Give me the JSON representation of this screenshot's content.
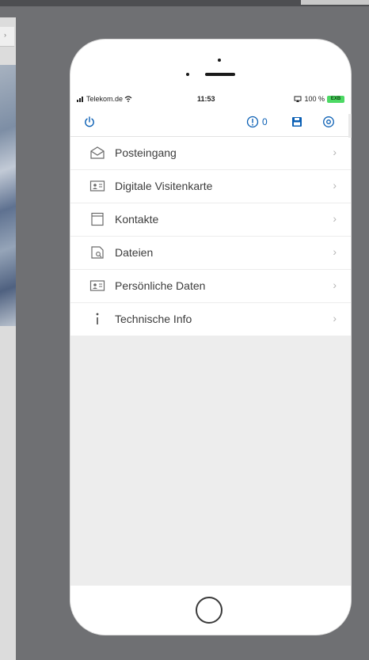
{
  "status_bar": {
    "carrier": "Telekom.de",
    "time": "11:53",
    "battery_percent": "100 %",
    "battery_badge": "EXB"
  },
  "toolbar": {
    "info_count": "0"
  },
  "menu": {
    "items": [
      {
        "label": "Posteingang",
        "icon": "envelope-icon"
      },
      {
        "label": "Digitale Visitenkarte",
        "icon": "id-card-icon"
      },
      {
        "label": "Kontakte",
        "icon": "contact-book-icon"
      },
      {
        "label": "Dateien",
        "icon": "file-search-icon"
      },
      {
        "label": "Persönliche Daten",
        "icon": "person-card-icon"
      },
      {
        "label": "Technische Info",
        "icon": "info-icon"
      }
    ]
  },
  "colors": {
    "accent": "#0a5fb4",
    "background": "#6f7073",
    "battery": "#4cd964"
  }
}
